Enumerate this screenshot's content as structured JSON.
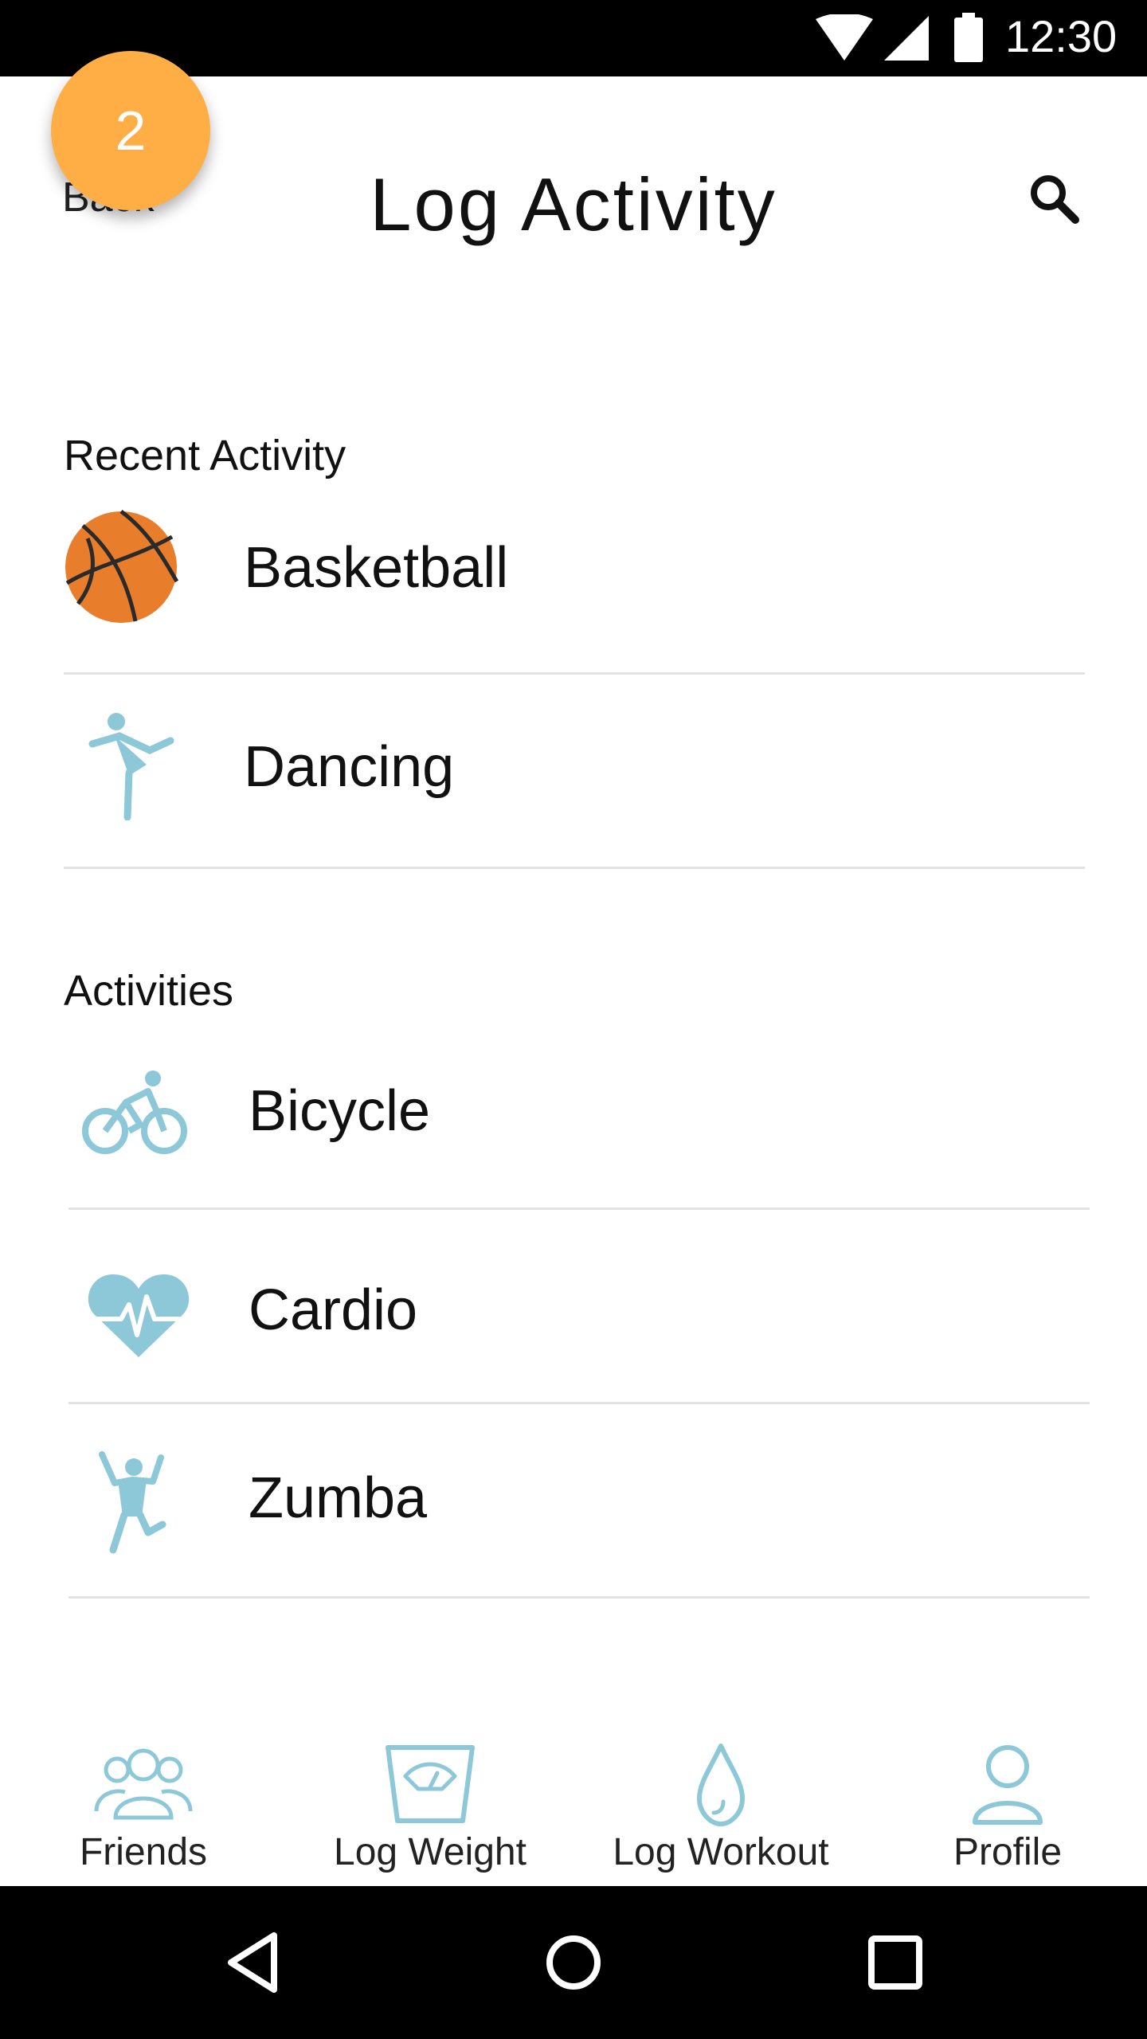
{
  "status_bar": {
    "time": "12:30"
  },
  "header": {
    "back_label": "Back",
    "title": "Log Activity"
  },
  "badge": {
    "count": "2",
    "color": "#FFAE45"
  },
  "recent": {
    "label": "Recent Activity",
    "items": [
      {
        "label": "Basketball",
        "icon": "basketball-icon"
      },
      {
        "label": "Dancing",
        "icon": "dancer-icon"
      }
    ]
  },
  "activities": {
    "label": "Activities",
    "items": [
      {
        "label": "Bicycle",
        "icon": "bicycle-icon"
      },
      {
        "label": "Cardio",
        "icon": "heart-pulse-icon"
      },
      {
        "label": "Zumba",
        "icon": "zumba-icon"
      }
    ]
  },
  "bottom_nav": {
    "items": [
      {
        "label": "Friends",
        "icon": "friends-icon"
      },
      {
        "label": "Log Weight",
        "icon": "scale-icon"
      },
      {
        "label": "Log Workout",
        "icon": "water-drop-icon"
      },
      {
        "label": "Profile",
        "icon": "profile-icon"
      }
    ]
  },
  "colors": {
    "accent": "#8DC8D8",
    "basketball": "#E87E2B",
    "divider": "#E3E3E3"
  }
}
